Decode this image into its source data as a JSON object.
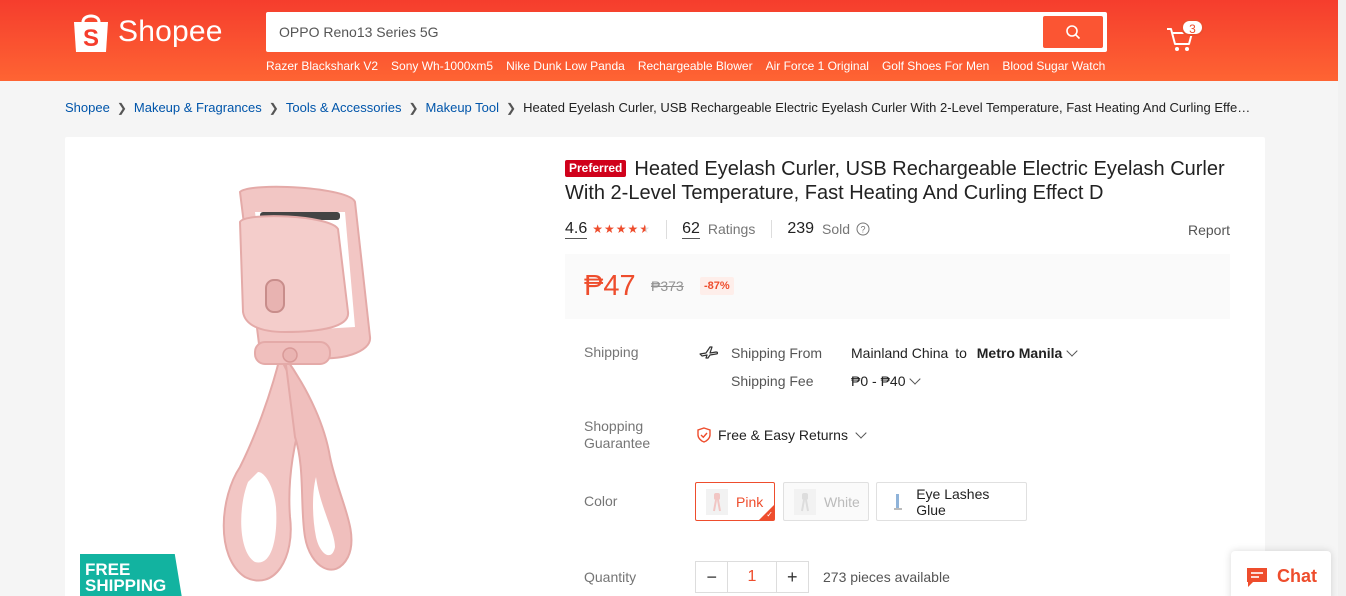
{
  "header": {
    "logo_text": "Shopee",
    "search": {
      "value": "OPPO Reno13 Series 5G"
    },
    "suggestions": [
      "Razer Blackshark V2",
      "Sony Wh-1000xm5",
      "Nike Dunk Low Panda",
      "Rechargeable Blower",
      "Air Force 1 Original",
      "Golf Shoes For Men",
      "Blood Sugar Watch"
    ],
    "cart_count": "3"
  },
  "breadcrumb": {
    "items": [
      "Shopee",
      "Makeup & Fragrances",
      "Tools & Accessories",
      "Makeup Tool"
    ],
    "current": "Heated Eyelash Curler, USB Rechargeable Electric Eyelash Curler With 2-Level Temperature, Fast Heating And Curling Effe…"
  },
  "product": {
    "badge": "Preferred",
    "title": "Heated Eyelash Curler, USB Rechargeable Electric Eyelash Curler With 2-Level Temperature, Fast Heating And Curling Effect D",
    "rating": "4.6",
    "rating_stars": 4.6,
    "ratings_count": "62",
    "ratings_label": "Ratings",
    "sold_count": "239",
    "sold_label": "Sold",
    "report_label": "Report",
    "price": "₱47",
    "original_price": "₱373",
    "discount": "-87%",
    "free_shipping_line1": "FREE",
    "free_shipping_line2": "SHIPPING"
  },
  "shipping": {
    "label": "Shipping",
    "from_label": "Shipping From",
    "from_value": "Mainland China",
    "to_word": "to",
    "destination": "Metro Manila",
    "fee_label": "Shipping Fee",
    "fee_value": "₱0 - ₱40"
  },
  "guarantee": {
    "label_line1": "Shopping",
    "label_line2": "Guarantee",
    "value": "Free & Easy Returns"
  },
  "color": {
    "label": "Color",
    "options": [
      "Pink",
      "White",
      "Eye Lashes Glue"
    ],
    "selected": "Pink"
  },
  "quantity": {
    "label": "Quantity",
    "value": "1",
    "minus": "−",
    "plus": "+",
    "available": "273 pieces available"
  },
  "chat": {
    "label": "Chat"
  },
  "colors": {
    "brand": "#ee4d2d",
    "product": "#f2c6c4"
  }
}
